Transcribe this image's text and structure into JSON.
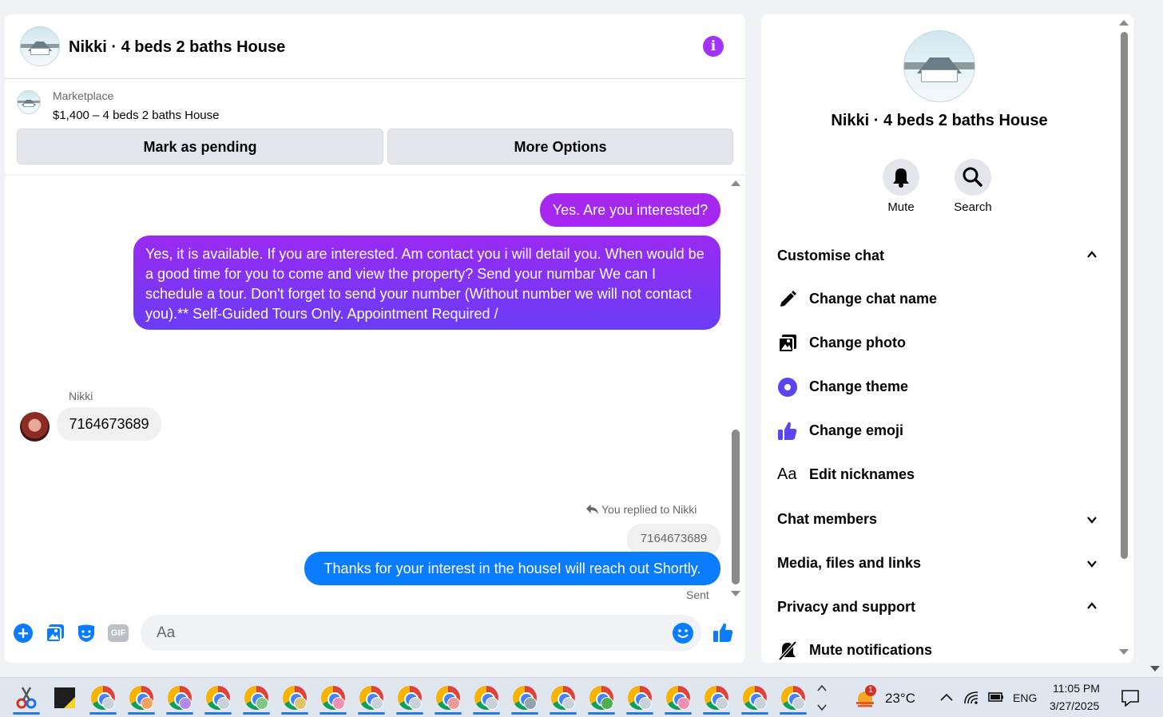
{
  "chat": {
    "title": "Nikki · 4 beds 2 baths House",
    "marketplace_label": "Marketplace",
    "listing": "$1,400 – 4 beds 2 baths House",
    "mark_pending_label": "Mark as pending",
    "more_options_label": "More Options",
    "messages": {
      "m1": "Yes. Are you interested?",
      "m2": "Yes, it is available. If you are interested.  Am contact you i will detail you.  When would be a good time for you to come and view the property? Send your numbar We can I schedule a tour.  Don't forget to send your number (Without number we will not contact you).** Self-Guided Tours Only. Appointment Required /",
      "sender": "Nikki",
      "m3": "7164673689",
      "reply_note": "You replied to Nikki",
      "reply_quote": "7164673689",
      "m4": "Thanks for your interest in the houseI will reach out Shortly.",
      "status": "Sent"
    },
    "composer": {
      "placeholder": "Aa",
      "gif_label": "GIF"
    }
  },
  "info_panel": {
    "title": "Nikki · 4 beds 2 baths House",
    "mute_label": "Mute",
    "search_label": "Search",
    "customise_header": "Customise chat",
    "items": {
      "change_name": "Change chat name",
      "change_photo": "Change photo",
      "change_theme": "Change theme",
      "change_emoji": "Change emoji",
      "edit_nicknames": "Edit nicknames",
      "nickname_glyph": "Aa"
    },
    "chat_members": "Chat members",
    "media": "Media, files and links",
    "privacy": "Privacy and support",
    "mute_notifications": "Mute notifications"
  },
  "taskbar": {
    "weather": "23°C",
    "weather_badge": "1",
    "lang": "ENG",
    "time": "11:05 PM",
    "date": "3/27/2025"
  },
  "colors": {
    "messenger_blue": "#0a7cff",
    "purple": "#a628ee",
    "theme_indigo": "#5b44f2"
  }
}
